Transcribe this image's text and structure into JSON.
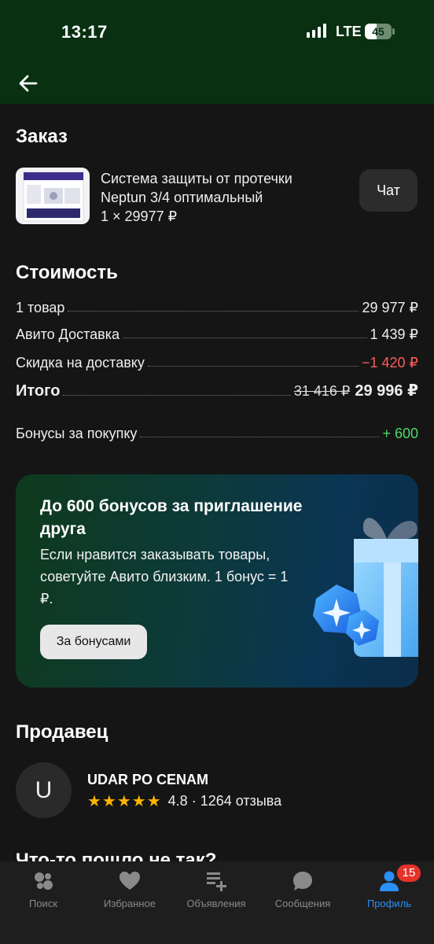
{
  "status_bar": {
    "time": "13:17",
    "network": "LTE",
    "battery": "45",
    "battery_level": 0.45
  },
  "header": {
    "back_icon": "arrow-left-icon"
  },
  "order": {
    "title": "Заказ",
    "product_name": "Система защиты от протечки Neptun 3/4 оптимальный",
    "product_qty_price": "1 × 29977 ₽",
    "chat_label": "Чат"
  },
  "cost": {
    "title": "Стоимость",
    "rows": [
      {
        "label": "1 товар",
        "value": "29 977 ₽"
      },
      {
        "label": "Авито Доставка",
        "value": "1 439 ₽"
      },
      {
        "label": "Скидка на доставку",
        "value": "−1 420 ₽"
      }
    ],
    "total": {
      "label": "Итого",
      "old_value": "31 416 ₽",
      "value": "29 996 ₽"
    },
    "bonus": {
      "label": "Бонусы за покупку",
      "value": "+ 600"
    }
  },
  "promo": {
    "title": "До 600 бонусов за приглашение друга",
    "text": "Если нравится заказывать товары, советуйте Авито близким. 1 бонус = 1 ₽.",
    "button_label": "За бонусами",
    "image_icon": "gift-box-icon"
  },
  "seller": {
    "title": "Продавец",
    "avatar_letter": "U",
    "name": "UDAR PO CENAM",
    "stars": "★★★★★",
    "rating": "4.8",
    "reviews": "· 1264 отзыва"
  },
  "partial_heading": "Что-то пошло не так?",
  "tabbar": {
    "items": [
      {
        "label": "Поиск",
        "icon": "search-dots-icon"
      },
      {
        "label": "Избранное",
        "icon": "heart-icon"
      },
      {
        "label": "Объявления",
        "icon": "listings-add-icon"
      },
      {
        "label": "Сообщения",
        "icon": "chat-bubble-icon"
      },
      {
        "label": "Профиль",
        "icon": "profile-icon"
      }
    ],
    "active": "Профиль",
    "profile_badge": "15"
  },
  "colors": {
    "accent": "#2a8ff7",
    "header_bg": "#083011",
    "discount": "#ff5c5c",
    "bonus": "#4fd86b",
    "stars": "#ffb400"
  }
}
